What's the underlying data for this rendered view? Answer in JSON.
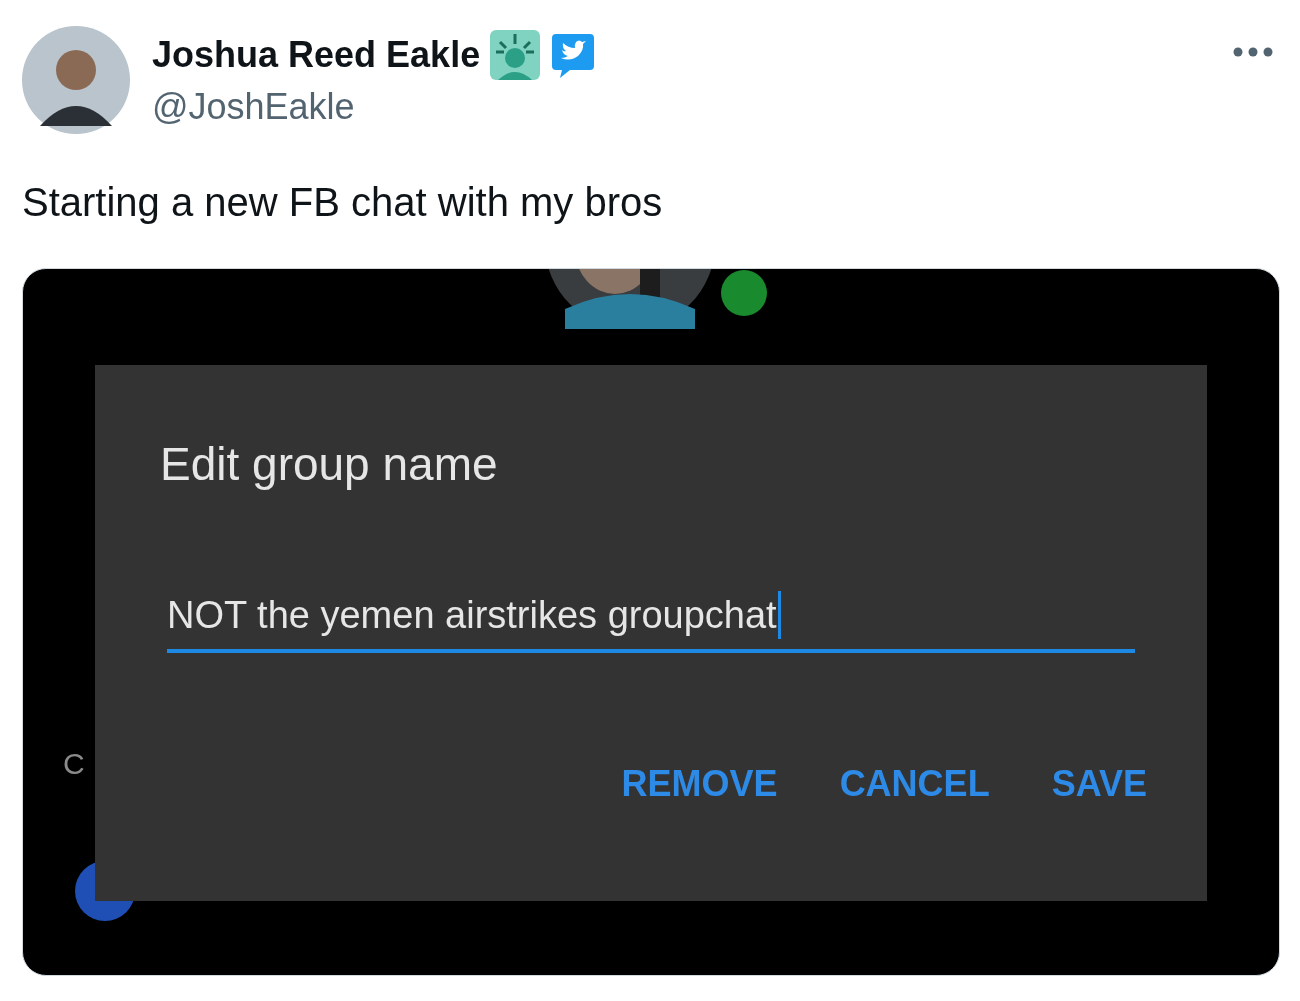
{
  "tweet": {
    "author": {
      "name": "Joshua Reed Eakle",
      "handle": "@JoshEakle",
      "verified": true
    },
    "text": "Starting a new FB chat with my bros",
    "media": {
      "online": true,
      "background_label": "C",
      "dialog": {
        "title": "Edit group name",
        "field": {
          "value": "NOT the yemen airstrikes groupchat",
          "focused": true
        },
        "buttons": [
          "REMOVE",
          "CANCEL",
          "SAVE"
        ]
      }
    }
  }
}
